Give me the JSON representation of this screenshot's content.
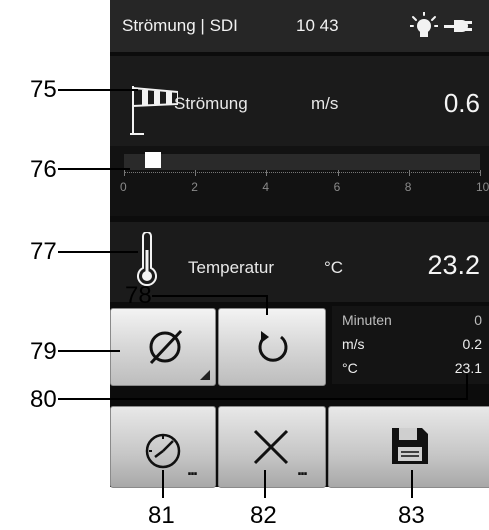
{
  "statusbar": {
    "title": "Strömung | SDI",
    "time": "10 43",
    "bulb_icon": "light-bulb-icon",
    "plug_icon": "power-plug-icon"
  },
  "flow": {
    "label": "Strömung",
    "unit": "m/s",
    "value": "0.6",
    "icon": "windsock-icon"
  },
  "flow_scale": {
    "ticks": [
      "0",
      "2",
      "4",
      "6",
      "8",
      "10"
    ],
    "level": 0.06
  },
  "temperature": {
    "label": "Temperatur",
    "unit": "°C",
    "value": "23.2",
    "icon": "thermometer-icon"
  },
  "buttons": {
    "average_icon": "average-diameter-icon",
    "reset_icon": "circular-arrow-icon",
    "timer_icon": "stopwatch-icon",
    "clear_icon": "cross-icon",
    "save_icon": "floppy-disk-icon",
    "more_text": "..."
  },
  "info": {
    "rows": [
      {
        "key": "Minuten",
        "value": "0"
      },
      {
        "key": "m/s",
        "value": "0.2"
      },
      {
        "key": "°C",
        "value": "23.1"
      }
    ]
  },
  "callouts": [
    "75",
    "76",
    "77",
    "78",
    "79",
    "80",
    "81",
    "82",
    "83"
  ],
  "colors": {
    "screen_bg": "#0c0c0c",
    "statusbar_bg": "#262626",
    "panel_bg": "#1b1b1b",
    "button_face": "#d4d4d4"
  }
}
